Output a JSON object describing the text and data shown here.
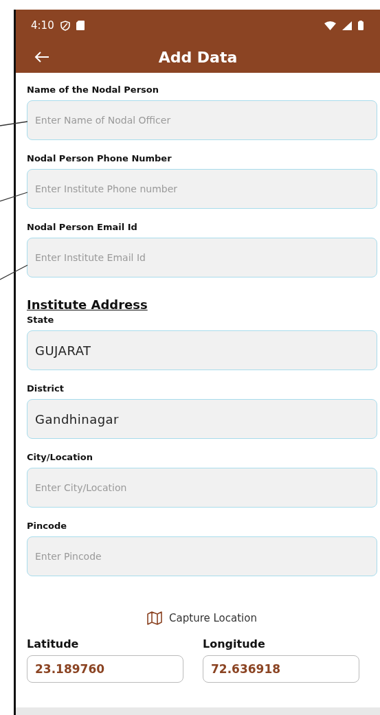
{
  "status_bar": {
    "time": "4:10"
  },
  "app_bar": {
    "title": "Add Data"
  },
  "fields": [
    {
      "label": "Name of the Nodal Person",
      "placeholder": "Enter Name of Nodal Officer"
    },
    {
      "label": "Nodal Person Phone Number",
      "placeholder": "Enter Institute Phone number"
    },
    {
      "label": "Nodal Person Email Id",
      "placeholder": "Enter Institute Email Id"
    }
  ],
  "address": {
    "heading": "Institute Address",
    "fields": [
      {
        "label": "State",
        "value": "GUJARAT"
      },
      {
        "label": "District",
        "value": "Gandhinagar"
      },
      {
        "label": "City/Location",
        "placeholder": "Enter City/Location"
      },
      {
        "label": "Pincode",
        "placeholder": "Enter Pincode"
      }
    ]
  },
  "capture_location": {
    "label": "Capture Location"
  },
  "coordinates": [
    {
      "label": "Latitude",
      "value": "23.189760"
    },
    {
      "label": "Longitude",
      "value": "72.636918"
    }
  ]
}
